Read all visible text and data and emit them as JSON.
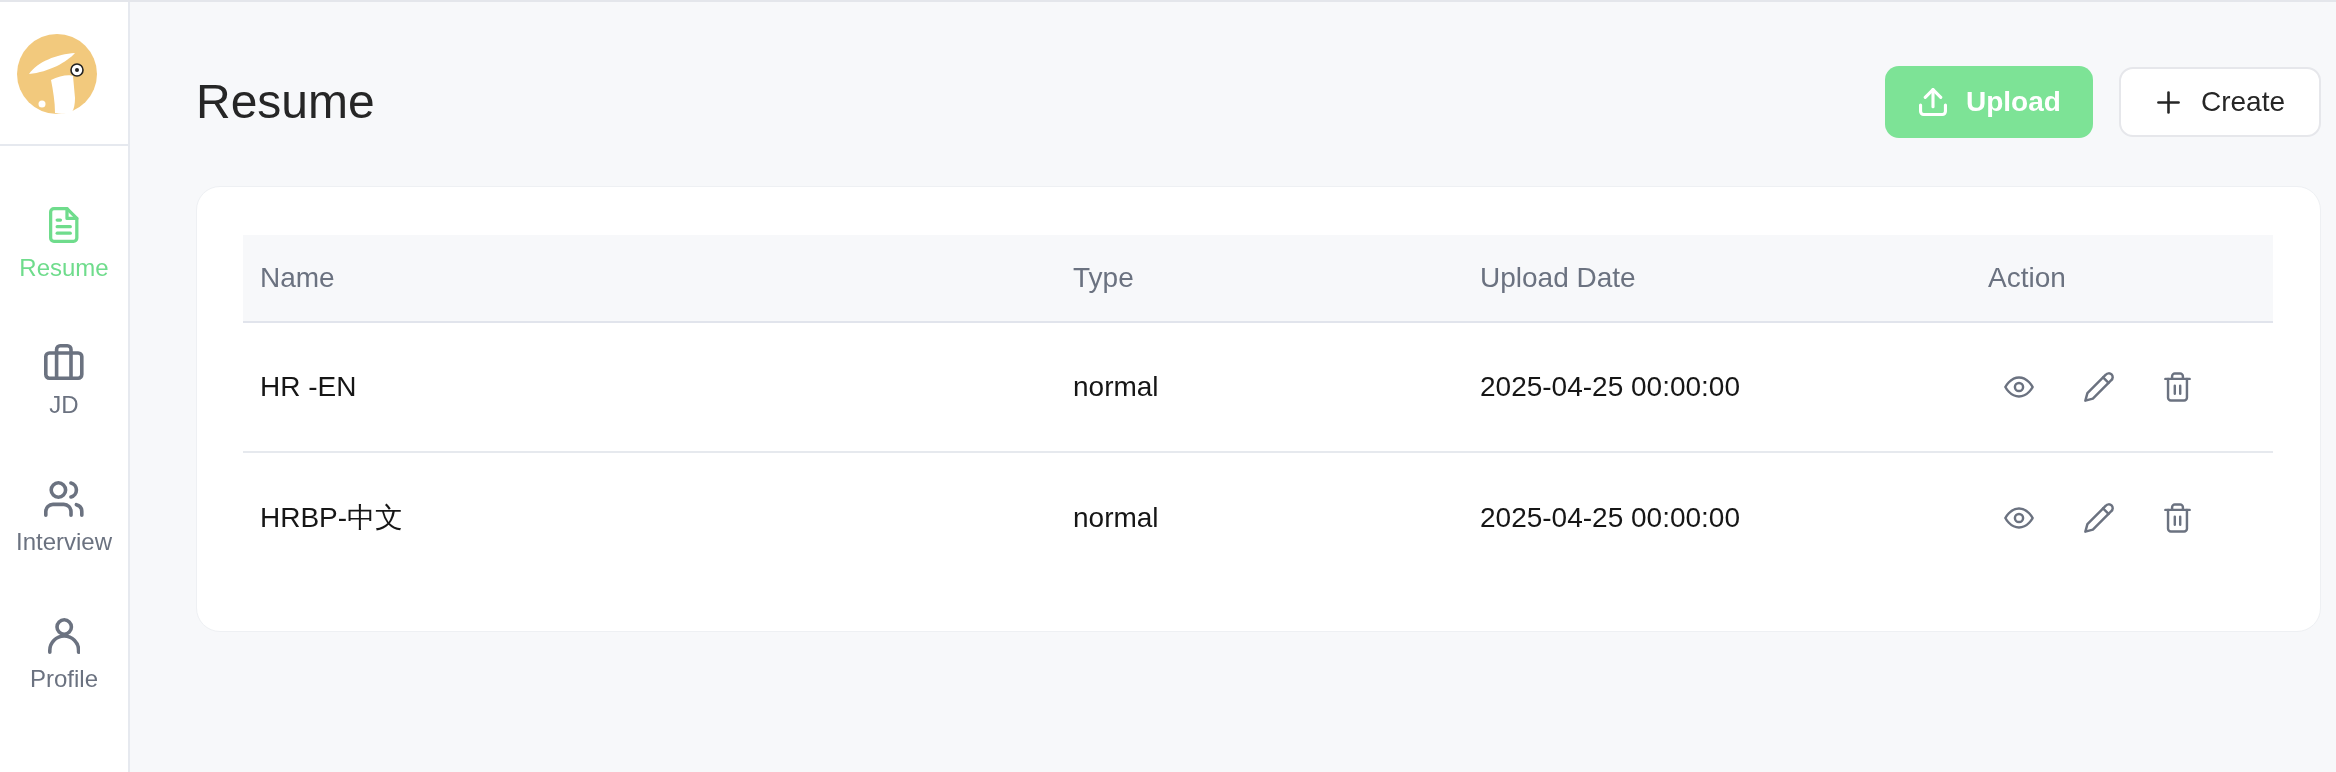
{
  "sidebar": {
    "items": [
      {
        "label": "Resume",
        "selected": true
      },
      {
        "label": "JD",
        "selected": false
      },
      {
        "label": "Interview",
        "selected": false
      },
      {
        "label": "Profile",
        "selected": false
      }
    ]
  },
  "header": {
    "title": "Resume",
    "buttons": [
      {
        "label": "Upload",
        "kind": "primary"
      },
      {
        "label": "Create",
        "kind": "secondary"
      }
    ]
  },
  "table": {
    "columns": [
      "Name",
      "Type",
      "Upload Date",
      "Action"
    ],
    "rows": [
      {
        "name": "HR -EN",
        "type": "normal",
        "upload_date": "2025-04-25 00:00:00"
      },
      {
        "name": "HRBP-中文",
        "type": "normal",
        "upload_date": "2025-04-25 00:00:00"
      }
    ]
  }
}
